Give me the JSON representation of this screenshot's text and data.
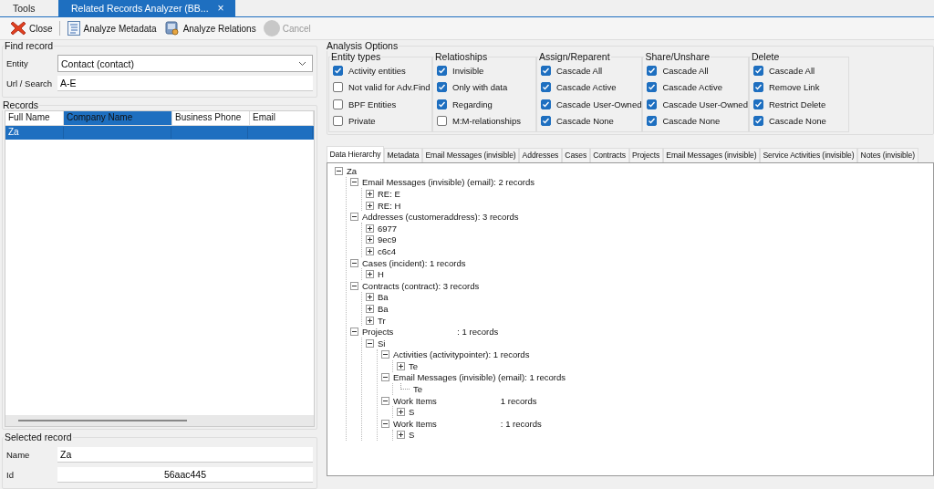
{
  "doc_tabs": [
    {
      "label": "Tools",
      "selected": false,
      "closable": false
    },
    {
      "label": "Related Records Analyzer (BB...",
      "selected": true,
      "closable": true
    }
  ],
  "close_glyph": "×",
  "toolbar": [
    {
      "kind": "close",
      "label": "Close",
      "disabled": false
    },
    {
      "kind": "metadata",
      "label": "Analyze Metadata",
      "disabled": false
    },
    {
      "kind": "relations",
      "label": "Analyze Relations",
      "disabled": false
    },
    {
      "kind": "stop",
      "label": "Cancel",
      "disabled": true
    }
  ],
  "find_record": {
    "title": "Find record",
    "entity_label": "Entity",
    "entity_value": "Contact (contact)",
    "search_label": "Url / Search",
    "search_value": "A-E"
  },
  "records": {
    "title": "Records",
    "columns": [
      {
        "label": "Full Name",
        "selected": false
      },
      {
        "label": "Company Name",
        "selected": true
      },
      {
        "label": "Business Phone",
        "selected": false
      },
      {
        "label": "Email",
        "selected": false
      }
    ],
    "rows": [
      {
        "cells": [
          "Za",
          "",
          "",
          ""
        ],
        "selected": true
      }
    ]
  },
  "selected_record": {
    "title": "Selected record",
    "name_label": "Name",
    "name_value": "Za",
    "id_label": "Id",
    "id_value": "56aac445"
  },
  "analysis_options": {
    "title": "Analysis Options",
    "groups": [
      {
        "title": "Entity types",
        "options": [
          {
            "label": "Activity entities",
            "checked": true
          },
          {
            "label": "Not valid for Adv.Find",
            "checked": false
          },
          {
            "label": "BPF Entities",
            "checked": false
          },
          {
            "label": "Private",
            "checked": false
          }
        ]
      },
      {
        "title": "Relatioships",
        "options": [
          {
            "label": "Invisible",
            "checked": true
          },
          {
            "label": "Only with data",
            "checked": true
          },
          {
            "label": "Regarding",
            "checked": true
          },
          {
            "label": "M:M-relationships",
            "checked": false
          }
        ]
      },
      {
        "title": "Assign/Reparent",
        "options": [
          {
            "label": "Cascade All",
            "checked": true
          },
          {
            "label": "Cascade Active",
            "checked": true
          },
          {
            "label": "Cascade User-Owned",
            "checked": true
          },
          {
            "label": "Cascade None",
            "checked": true
          }
        ]
      },
      {
        "title": "Share/Unshare",
        "options": [
          {
            "label": "Cascade All",
            "checked": true
          },
          {
            "label": "Cascade Active",
            "checked": true
          },
          {
            "label": "Cascade User-Owned",
            "checked": true
          },
          {
            "label": "Cascade None",
            "checked": true
          }
        ]
      },
      {
        "title": "Delete",
        "options": [
          {
            "label": "Cascade All",
            "checked": true
          },
          {
            "label": "Remove Link",
            "checked": true
          },
          {
            "label": "Restrict Delete",
            "checked": true
          },
          {
            "label": "Cascade None",
            "checked": true
          }
        ]
      }
    ]
  },
  "result_tabs": [
    {
      "label": "Data Hierarchy",
      "selected": true
    },
    {
      "label": "Metadata",
      "selected": false
    },
    {
      "label": "Email Messages (invisible)",
      "selected": false
    },
    {
      "label": "Addresses",
      "selected": false
    },
    {
      "label": "Cases",
      "selected": false
    },
    {
      "label": "Contracts",
      "selected": false
    },
    {
      "label": "Projects",
      "selected": false
    },
    {
      "label": "Email Messages (invisible)",
      "selected": false
    },
    {
      "label": "Service Activities (invisible)",
      "selected": false
    },
    {
      "label": "Notes (invisible)",
      "selected": false
    }
  ],
  "tree": [
    {
      "label": "Za",
      "kind": "node",
      "expanded": true,
      "children": [
        {
          "label": "Email Messages (invisible) (email): 2 records",
          "kind": "node",
          "expanded": true,
          "children": [
            {
              "label": "RE: E",
              "kind": "node",
              "expanded": false
            },
            {
              "label": "RE: H",
              "kind": "node",
              "expanded": false
            }
          ]
        },
        {
          "label": "Addresses (customeraddress): 3 records",
          "kind": "node",
          "expanded": true,
          "children": [
            {
              "label": "6977",
              "kind": "node",
              "expanded": false
            },
            {
              "label": "9ec9",
              "kind": "node",
              "expanded": false
            },
            {
              "label": "c6c4",
              "kind": "node",
              "expanded": false
            }
          ]
        },
        {
          "label": "Cases (incident): 1 records",
          "kind": "node",
          "expanded": true,
          "children": [
            {
              "label": "H",
              "kind": "node",
              "expanded": false
            }
          ]
        },
        {
          "label": "Contracts (contract): 3 records",
          "kind": "node",
          "expanded": true,
          "children": [
            {
              "label": "Ba",
              "kind": "node",
              "expanded": false
            },
            {
              "label": "Ba",
              "kind": "node",
              "expanded": false
            },
            {
              "label": "Tr",
              "kind": "node",
              "expanded": false
            }
          ]
        },
        {
          "label": "Projects",
          "suffix": ": 1 records",
          "kind": "node",
          "expanded": true,
          "children": [
            {
              "label": "Si",
              "kind": "node",
              "expanded": true,
              "children": [
                {
                  "label": "Activities (activitypointer): 1 records",
                  "kind": "node",
                  "expanded": true,
                  "children": [
                    {
                      "label": "Te",
                      "kind": "node",
                      "expanded": false
                    }
                  ]
                },
                {
                  "label": "Email Messages (invisible) (email): 1 records",
                  "kind": "node",
                  "expanded": true,
                  "children": [
                    {
                      "label": "Te",
                      "kind": "leaf"
                    }
                  ]
                },
                {
                  "label": "Work Items",
                  "suffix": "1 records",
                  "kind": "node",
                  "expanded": true,
                  "children": [
                    {
                      "label": "S",
                      "kind": "node",
                      "expanded": false
                    }
                  ]
                },
                {
                  "label": "Work Items",
                  "suffix": ": 1 records",
                  "kind": "node",
                  "expanded": true,
                  "children": [
                    {
                      "label": "S",
                      "kind": "node",
                      "expanded": false
                    }
                  ]
                }
              ]
            }
          ]
        }
      ]
    }
  ]
}
